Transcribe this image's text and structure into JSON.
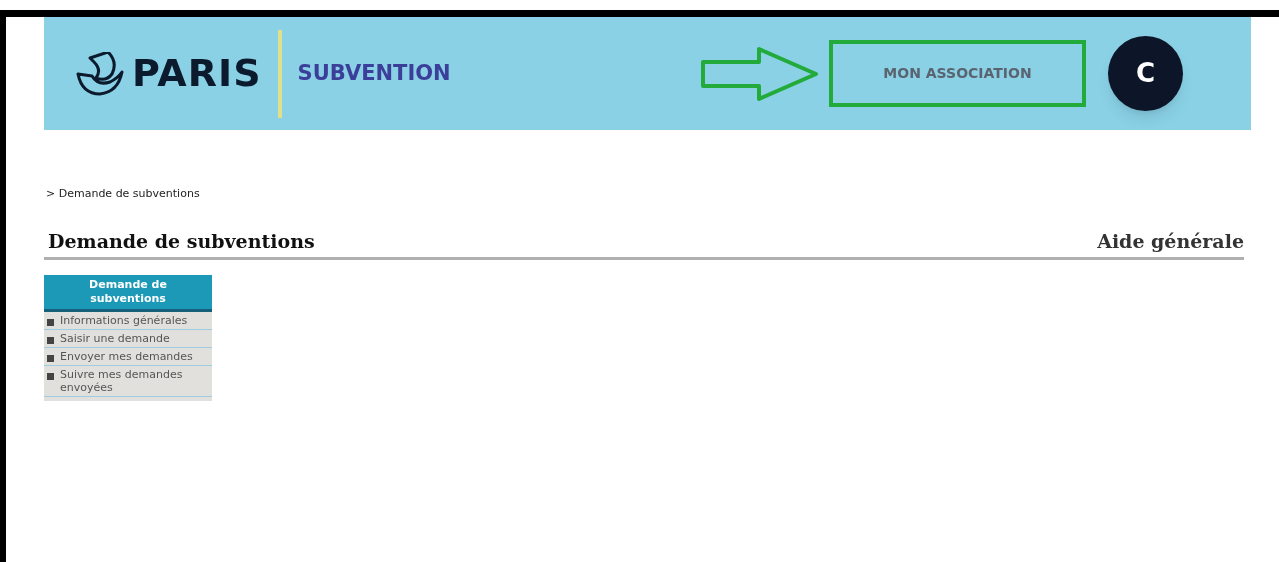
{
  "header": {
    "logo_text": "PARIS",
    "app_title": "SUBVENTION",
    "account_link": {
      "label": "MON ASSOCIATION",
      "highlighted": true
    },
    "avatar": {
      "initial": "C"
    }
  },
  "breadcrumb": "> Demande de subventions",
  "page_title": "Demande de subventions",
  "help_link": "Aide générale",
  "side_menu": {
    "title": "Demande de subventions",
    "items": [
      {
        "label": "Informations générales"
      },
      {
        "label": "Saisir une demande"
      },
      {
        "label": "Envoyer mes demandes"
      },
      {
        "label": "Suivre mes demandes envoyées"
      }
    ]
  }
}
